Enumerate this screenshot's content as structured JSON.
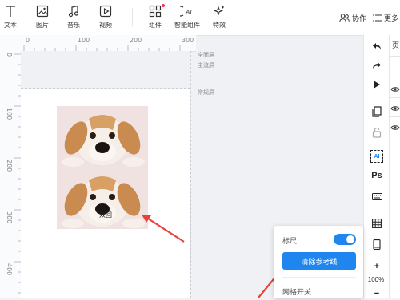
{
  "toolbar": {
    "items": [
      {
        "label": "文本",
        "icon": "text-icon"
      },
      {
        "label": "图片",
        "icon": "image-icon"
      },
      {
        "label": "音乐",
        "icon": "music-icon"
      },
      {
        "label": "视频",
        "icon": "video-icon"
      },
      {
        "label": "组件",
        "icon": "component-icon"
      },
      {
        "label": "智能组件",
        "icon": "ai-component-icon"
      },
      {
        "label": "特效",
        "icon": "sparkle-icon"
      }
    ],
    "collab_label": "协作",
    "more_label": "更多"
  },
  "ruler": {
    "top_ticks": [
      "0",
      "100",
      "200",
      "300"
    ],
    "left_ticks": [
      "0",
      "100",
      "200",
      "300",
      "400"
    ]
  },
  "guides": {
    "full_screen": "全面屏",
    "mainstream": "主流屏",
    "normal": "常规屏"
  },
  "images": {
    "caption": "双回"
  },
  "right_tools": {
    "ai_label": "AI",
    "ps_label": "Ps",
    "zoom": "100%",
    "plus": "+",
    "minus": "−"
  },
  "right_edge_tab": "页",
  "popup": {
    "ruler_label": "标尺",
    "ruler_on": true,
    "clear_button": "清除参考线",
    "grid_label": "网格开关"
  },
  "colors": {
    "accent": "#1f86f0",
    "arrow": "#e8403a"
  }
}
